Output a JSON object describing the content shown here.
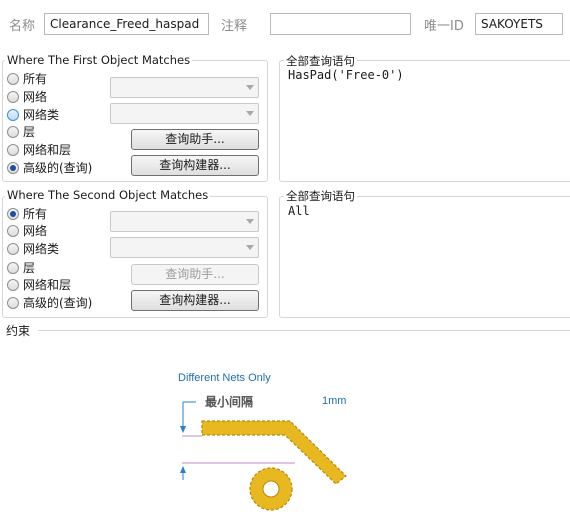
{
  "header": {
    "name_label": "名称",
    "name_value": "Clearance_Freed_haspad",
    "comment_label": "注释",
    "comment_value": "",
    "uid_label": "唯一ID",
    "uid_value": "SAKOYETS"
  },
  "first_object": {
    "title": "Where The First Object Matches",
    "options": [
      "所有",
      "网络",
      "网络类",
      "层",
      "网络和层",
      "高级的(查询)"
    ],
    "selected_index": 5,
    "query_helper_label": "查询助手...",
    "query_builder_label": "查询构建器...",
    "full_query_title": "全部查询语句",
    "full_query": "HasPad('Free-0')"
  },
  "second_object": {
    "title": "Where The Second Object Matches",
    "options": [
      "所有",
      "网络",
      "网络类",
      "层",
      "网络和层",
      "高级的(查询)"
    ],
    "selected_index": 0,
    "query_helper_label": "查询助手...",
    "query_builder_label": "查询构建器...",
    "full_query_title": "全部查询语句",
    "full_query": "All"
  },
  "constraints": {
    "title": "约束",
    "scope_label": "Different Nets Only",
    "min_clearance_label": "最小间隔",
    "min_clearance_value": "1mm"
  },
  "colors": {
    "accent_text": "#1f6fb2",
    "copper": "#e8b820",
    "copper_edge": "#b8860b"
  }
}
